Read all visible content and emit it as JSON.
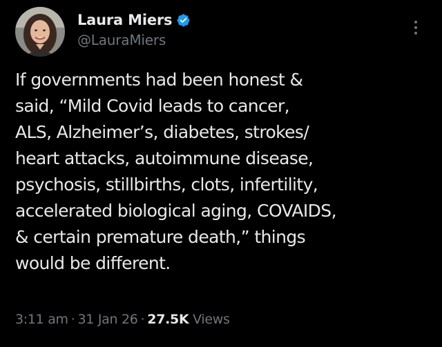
{
  "author": {
    "display_name": "Laura Miers",
    "handle": "@LauraMiers",
    "verified": true,
    "verified_color": "#1d9bf0"
  },
  "tweet": {
    "lines": [
      "If governments had been honest &",
      "said, “Mild Covid leads to cancer,",
      "ALS, Alzheimer’s, diabetes, strokes/",
      "heart attacks, autoimmune disease,",
      "psychosis, stillbirths, clots, infertility,",
      "accelerated biological aging, COVAIDS,",
      "& certain premature death,” things",
      "would be different."
    ]
  },
  "meta": {
    "time": "3:11 am",
    "separator": "·",
    "date": "31 Jan 26",
    "views_count": "27.5K",
    "views_label": "Views"
  },
  "icons": {
    "avatar": "profile-photo",
    "verified": "verified-badge-icon",
    "more": "more-options-icon"
  },
  "colors": {
    "background": "#000000",
    "primary_text": "#e7e9ea",
    "secondary_text": "#71767b"
  }
}
